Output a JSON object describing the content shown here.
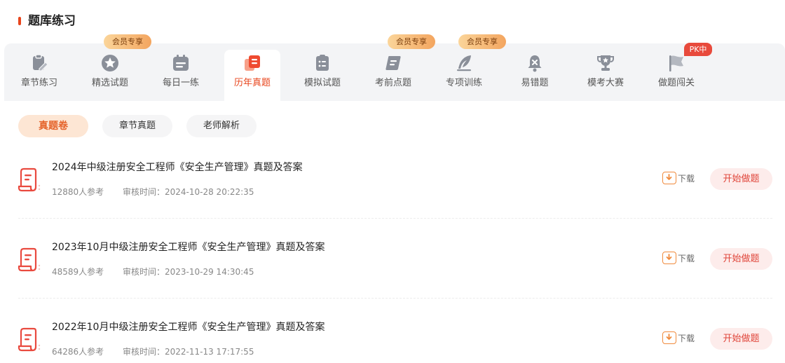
{
  "header": {
    "title": "题库练习"
  },
  "tabs": [
    {
      "label": "章节练习"
    },
    {
      "label": "精选试题",
      "badge": "会员专享"
    },
    {
      "label": "每日一练"
    },
    {
      "label": "历年真题",
      "active": true
    },
    {
      "label": "模拟试题"
    },
    {
      "label": "考前点题",
      "badge": "会员专享"
    },
    {
      "label": "专项训练",
      "badge": "会员专享"
    },
    {
      "label": "易错题"
    },
    {
      "label": "模考大赛"
    },
    {
      "label": "做题闯关",
      "badge": "PK中"
    }
  ],
  "filters": [
    {
      "label": "真题卷",
      "active": true
    },
    {
      "label": "章节真题"
    },
    {
      "label": "老师解析"
    }
  ],
  "papers": [
    {
      "title": "2024年中级注册安全工程师《安全生产管理》真题及答案",
      "participants": "12880人参考",
      "review_time": "审核时间：2024-10-28 20:22:35",
      "download": "下载",
      "start": "开始做题"
    },
    {
      "title": "2023年10月中级注册安全工程师《安全生产管理》真题及答案",
      "participants": "48589人参考",
      "review_time": "审核时间：2023-10-29 14:30:45",
      "download": "下载",
      "start": "开始做题"
    },
    {
      "title": "2022年10月中级注册安全工程师《安全生产管理》真题及答案",
      "participants": "64286人参考",
      "review_time": "审核时间：2022-11-13 17:17:55",
      "download": "下载",
      "start": "开始做题"
    }
  ],
  "colors": {
    "accent": "#e8451c",
    "tab_bg": "#f3f4f6",
    "chip_active_bg": "#fde6d4",
    "start_bg": "#fdeceb"
  }
}
